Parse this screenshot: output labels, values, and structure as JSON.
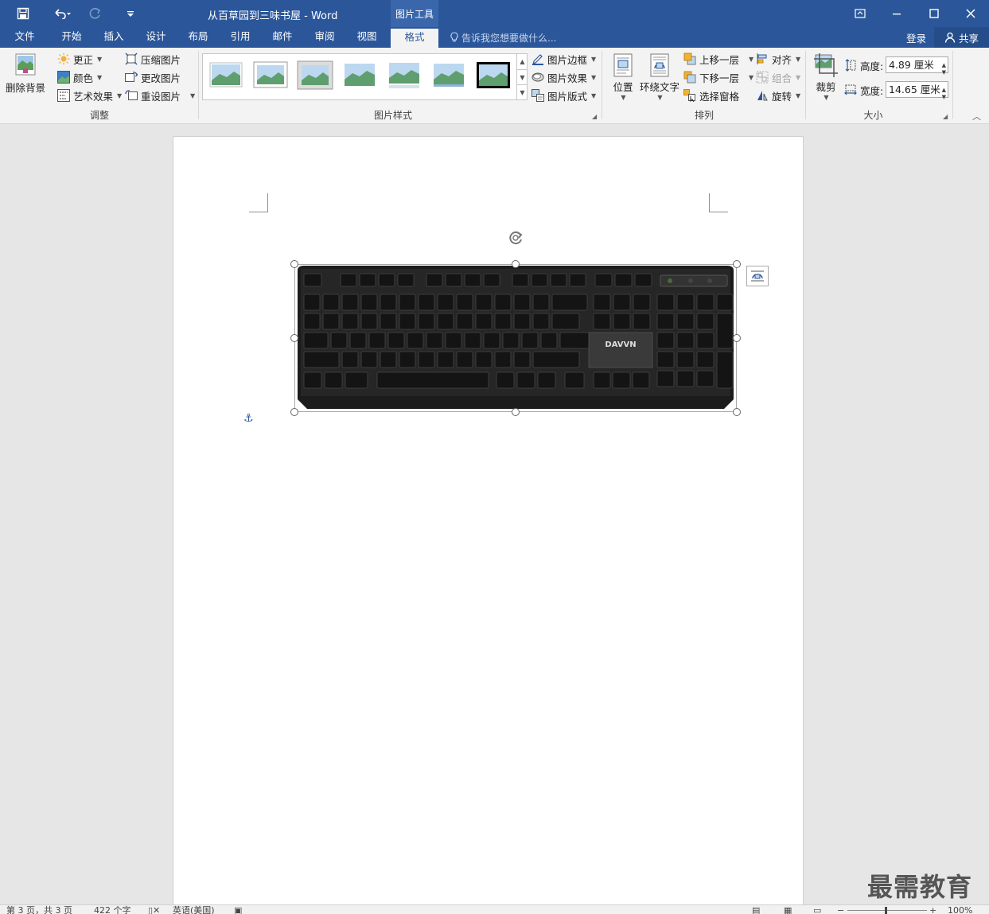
{
  "window": {
    "title": "从百草园到三味书屋 - Word",
    "context_tools": "图片工具",
    "controls": [
      "restore-ribbon-icon",
      "minimize-icon",
      "maximize-icon",
      "close-icon"
    ]
  },
  "quick_access": {
    "icons": [
      "save-icon",
      "undo-icon",
      "redo-icon",
      "customize-icon"
    ]
  },
  "tabs": {
    "file": "文件",
    "home": "开始",
    "insert": "插入",
    "design": "设计",
    "layout": "布局",
    "references": "引用",
    "mailings": "邮件",
    "review": "审阅",
    "view": "视图",
    "format": "格式",
    "active": "格式"
  },
  "tellme": {
    "placeholder": "告诉我您想要做什么..."
  },
  "account": {
    "login": "登录",
    "share": "共享"
  },
  "ribbon": {
    "adjust": {
      "label": "调整",
      "remove_bg": "删除背景",
      "corrections": "更正",
      "color": "颜色",
      "artistic": "艺术效果",
      "compress": "压缩图片",
      "change": "更改图片",
      "reset": "重设图片"
    },
    "styles": {
      "label": "图片样式",
      "border": "图片边框",
      "effects": "图片效果",
      "layout": "图片版式",
      "thumb_count": 7,
      "selected_thumb": 7
    },
    "arrange": {
      "label": "排列",
      "position": "位置",
      "wrap": "环绕文字",
      "forward": "上移一层",
      "backward": "下移一层",
      "selection_pane": "选择窗格",
      "align": "对齐",
      "group": "组合",
      "rotate": "旋转"
    },
    "size": {
      "label": "大小",
      "crop": "裁剪",
      "height_label": "高度:",
      "height_value": "4.89 厘米",
      "width_label": "宽度:",
      "width_value": "14.65 厘米"
    }
  },
  "document": {
    "image_alt": "keyboard-photo"
  },
  "statusbar": {
    "page": "第 3 页，共 3 页",
    "words": "422 个字",
    "language": "英语(美国)",
    "zoom": "100%"
  },
  "watermark": "最需教育",
  "colors": {
    "accent": "#2b579a",
    "ribbon_bg": "#f3f3f3",
    "doc_bg": "#e6e6e6"
  }
}
